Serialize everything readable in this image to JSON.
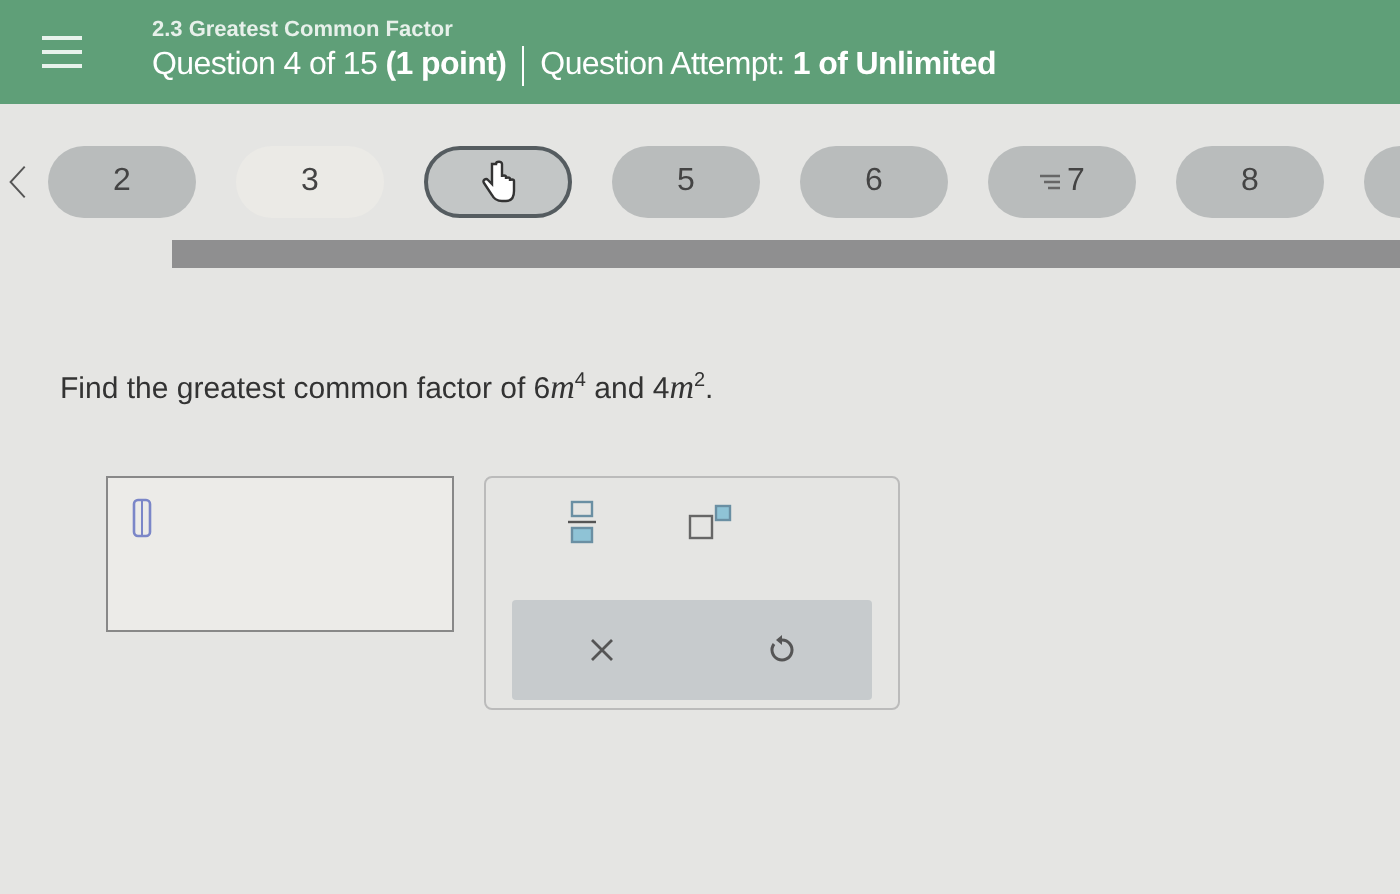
{
  "header": {
    "section_title": "2.3 Greatest Common Factor",
    "question_info": "Question 4 of 15 **(1 point)**",
    "attempt_info": "Question Attempt: **1 of Unlimited**"
  },
  "question_nav": [
    {
      "label": "2",
      "selected": false,
      "kind": "answered"
    },
    {
      "label": "3",
      "selected": false,
      "kind": "unanswered"
    },
    {
      "selected": true,
      "kind": "answered"
    },
    {
      "label": "5",
      "selected": false,
      "kind": "answered"
    },
    {
      "label": "6",
      "selected": false,
      "kind": "answered"
    },
    {
      "label": "7",
      "selected": false,
      "kind": "flagged"
    },
    {
      "label": "8",
      "selected": false,
      "kind": "answered"
    },
    {
      "selected": false,
      "kind": "answered"
    }
  ],
  "question": {
    "prefix": "Find the greatest common factor of",
    "terms": [
      {
        "coefficient": "6",
        "variable": "m",
        "exponent": "4"
      },
      {
        "coefficient": "4",
        "variable": "m",
        "exponent": "2"
      }
    ],
    "joiner": "and",
    "end": "."
  },
  "keypad": {
    "tools": [
      {
        "kind": "fraction"
      },
      {
        "kind": "superscript"
      }
    ],
    "actions": [
      {
        "kind": "clear"
      },
      {
        "kind": "undo"
      }
    ]
  }
}
